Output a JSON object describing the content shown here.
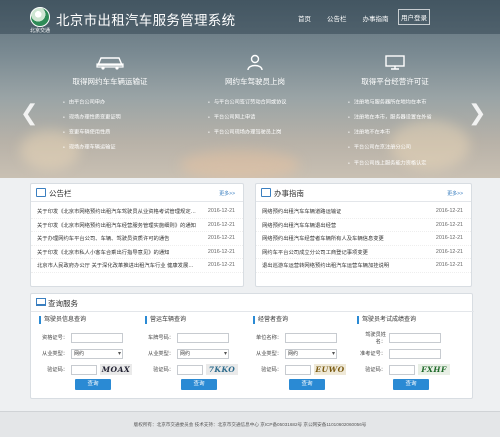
{
  "header": {
    "logo_sub": "北京交通",
    "site_title": "北京市出租汽车服务管理系统",
    "nav": [
      "首页",
      "公告栏",
      "办事指南",
      "用户登录"
    ]
  },
  "hero": {
    "prev_icon": "chevron-left-icon",
    "next_icon": "chevron-right-icon",
    "features": [
      {
        "icon": "car-icon",
        "title": "取得网约车车辆运输证",
        "items": [
          "由平台公司申办",
          "现场办理性质变更证明",
          "变更车辆使用性质",
          "现场办理车辆运输证"
        ]
      },
      {
        "icon": "driver-icon",
        "title": "网约车驾驶员上岗",
        "items": [
          "与平台公司签订劳动合同或协议",
          "平台公司网上申请",
          "平台公司现场办理驾驶员上岗"
        ]
      },
      {
        "icon": "platform-icon",
        "title": "取得平台经营许可证",
        "items": [
          "注册地与服务器所在地均在本市",
          "注册地在本市，服务器设置在外省",
          "注册地不在本市",
          "平台公司在京注册分公司",
          "平台公司线上服务能力资格认定"
        ]
      }
    ]
  },
  "notice": {
    "title": "公告栏",
    "more": "更多>>",
    "rows": [
      {
        "t": "关于印发《北京市网络预约出租汽车驾驶员从业资格考试管理规定（试...",
        "d": "2016-12-21"
      },
      {
        "t": "关于印发《北京市网络预约出租汽车经营服务管理实施细则》的通知",
        "d": "2016-12-21"
      },
      {
        "t": "关于办理网约车平台公司、车辆、驾驶员资质许可的通告",
        "d": "2016-12-21"
      },
      {
        "t": "关于印发《北京市私人小客车合乘出行指导意见》的通知",
        "d": "2016-12-21"
      },
      {
        "t": "北京市人民政府办公厅 关于深化改革推进出租汽车行业 健康发展的...",
        "d": "2016-12-21"
      }
    ]
  },
  "guide": {
    "title": "办事指南",
    "more": "更多>>",
    "rows": [
      {
        "t": "网络预约出租汽车车辆道路运输证",
        "d": "2016-12-21"
      },
      {
        "t": "网络预约出租汽车车辆退出经营",
        "d": "2016-12-21"
      },
      {
        "t": "网络预约出租汽车经营者车辆所有人及车辆信息变更",
        "d": "2016-12-21"
      },
      {
        "t": "网约车平台公司成立分公司工商登记事项变更",
        "d": "2016-12-21"
      },
      {
        "t": "退出巡游车运营转网络预约出租汽车运营车辆加挂说明",
        "d": "2016-12-21"
      }
    ]
  },
  "query": {
    "title": "查询服务",
    "columns": [
      {
        "title": "驾驶员信息查询",
        "fields": [
          {
            "label": "资格证号：",
            "value": "",
            "type": "input"
          },
          {
            "label": "从业类型：",
            "value": "网约",
            "type": "select"
          },
          {
            "label": "验证码：",
            "value": "",
            "type": "captcha",
            "captcha": "MOAX"
          }
        ],
        "button": "查询"
      },
      {
        "title": "营运车辆查询",
        "fields": [
          {
            "label": "车牌号码：",
            "value": "",
            "type": "input"
          },
          {
            "label": "从业类型：",
            "value": "网约",
            "type": "select"
          },
          {
            "label": "验证码：",
            "value": "",
            "type": "captcha",
            "captcha": "7KKO"
          }
        ],
        "button": "查询"
      },
      {
        "title": "经营者查询",
        "fields": [
          {
            "label": "单位名称：",
            "value": "",
            "type": "input"
          },
          {
            "label": "从业类型：",
            "value": "网约",
            "type": "select"
          },
          {
            "label": "验证码：",
            "value": "",
            "type": "captcha",
            "captcha": "EUWO"
          }
        ],
        "button": "查询"
      },
      {
        "title": "驾驶员考试成绩查询",
        "fields": [
          {
            "label": "驾驶员姓名：",
            "value": "",
            "type": "input"
          },
          {
            "label": "准考证号：",
            "value": "",
            "type": "input"
          },
          {
            "label": "验证码：",
            "value": "",
            "type": "captcha",
            "captcha": "FXHF"
          }
        ],
        "button": "查询"
      }
    ]
  },
  "footer": {
    "text": "版权所有：北京市交通委员会  技术支持：北京市交通信息中心  京ICP备05031682号  京公网安备11010602060056号"
  },
  "colors": {
    "accent": "#2a8ad4",
    "hero_top": "#5d6f7a"
  }
}
